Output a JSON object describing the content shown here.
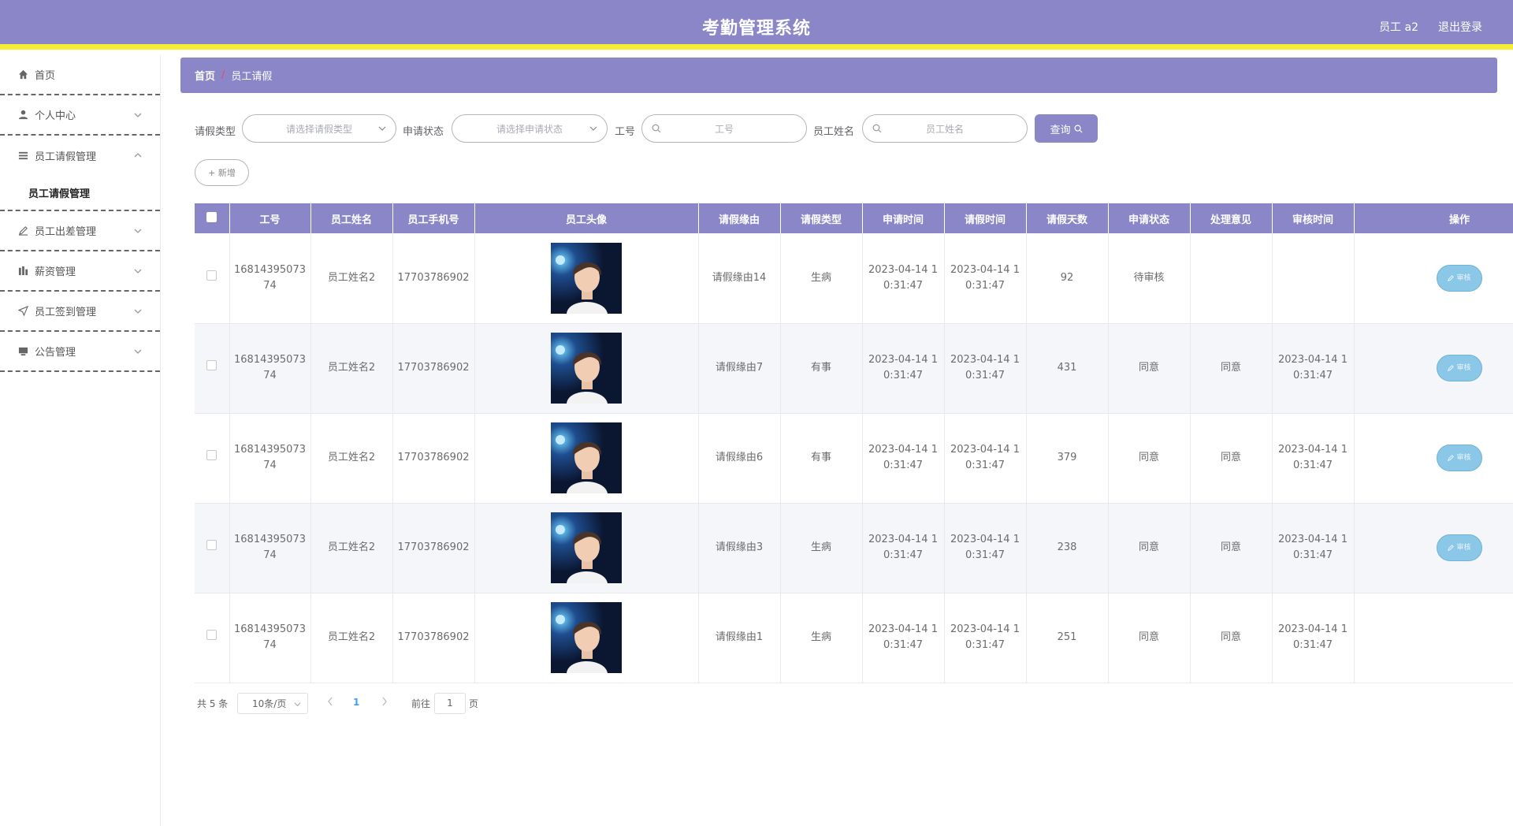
{
  "header": {
    "title": "考勤管理系统",
    "user": "员工 a2",
    "logout": "退出登录"
  },
  "sidebar": {
    "items": [
      {
        "label": "首页",
        "icon": "home-icon"
      },
      {
        "label": "个人中心",
        "icon": "user-icon"
      },
      {
        "label": "员工请假管理",
        "icon": "list-icon",
        "sub": "员工请假管理"
      },
      {
        "label": "员工出差管理",
        "icon": "edit-icon"
      },
      {
        "label": "薪资管理",
        "icon": "chart-icon"
      },
      {
        "label": "员工签到管理",
        "icon": "send-icon"
      },
      {
        "label": "公告管理",
        "icon": "monitor-icon"
      }
    ]
  },
  "breadcrumb": {
    "home": "首页",
    "separator": "/",
    "current": "员工请假"
  },
  "filters": {
    "leave_type_label": "请假类型",
    "leave_type_placeholder": "请选择请假类型",
    "status_label": "申请状态",
    "status_placeholder": "请选择申请状态",
    "emp_no_label": "工号",
    "emp_no_placeholder": "工号",
    "emp_name_label": "员工姓名",
    "emp_name_placeholder": "员工姓名",
    "query_label": "查询"
  },
  "add_button": "+ 新增",
  "table": {
    "columns": [
      "工号",
      "员工姓名",
      "员工手机号",
      "员工头像",
      "请假缘由",
      "请假类型",
      "申请时间",
      "请假时间",
      "请假天数",
      "申请状态",
      "处理意见",
      "审核时间",
      "操作"
    ],
    "rows": [
      {
        "emp_no": "1681439507374",
        "name": "员工姓名2",
        "phone": "17703786902",
        "reason": "请假缘由14",
        "type": "生病",
        "apply_time": "2023-04-14 10:31:47",
        "leave_time": "2023-04-14 10:31:47",
        "days": "92",
        "status": "待审核",
        "opinion": "",
        "audit_time": "",
        "action": "审核"
      },
      {
        "emp_no": "1681439507374",
        "name": "员工姓名2",
        "phone": "17703786902",
        "reason": "请假缘由7",
        "type": "有事",
        "apply_time": "2023-04-14 10:31:47",
        "leave_time": "2023-04-14 10:31:47",
        "days": "431",
        "status": "同意",
        "opinion": "同意",
        "audit_time": "2023-04-14 10:31:47",
        "action": "审核"
      },
      {
        "emp_no": "1681439507374",
        "name": "员工姓名2",
        "phone": "17703786902",
        "reason": "请假缘由6",
        "type": "有事",
        "apply_time": "2023-04-14 10:31:47",
        "leave_time": "2023-04-14 10:31:47",
        "days": "379",
        "status": "同意",
        "opinion": "同意",
        "audit_time": "2023-04-14 10:31:47",
        "action": "审核"
      },
      {
        "emp_no": "1681439507374",
        "name": "员工姓名2",
        "phone": "17703786902",
        "reason": "请假缘由3",
        "type": "生病",
        "apply_time": "2023-04-14 10:31:47",
        "leave_time": "2023-04-14 10:31:47",
        "days": "238",
        "status": "同意",
        "opinion": "同意",
        "audit_time": "2023-04-14 10:31:47",
        "action": "审核"
      },
      {
        "emp_no": "1681439507374",
        "name": "员工姓名2",
        "phone": "17703786902",
        "reason": "请假缘由1",
        "type": "生病",
        "apply_time": "2023-04-14 10:31:47",
        "leave_time": "2023-04-14 10:31:47",
        "days": "251",
        "status": "同意",
        "opinion": "同意",
        "audit_time": "2023-04-14 10:31:47",
        "action": ""
      }
    ]
  },
  "pagination": {
    "total": "共 5 条",
    "page_size": "10条/页",
    "current": "1",
    "goto": "前往",
    "goto_value": "1",
    "unit": "页"
  },
  "colors": {
    "primary": "#8a86c7",
    "accent_bar": "#f5ee35",
    "audit_button": "#8bc7e6"
  }
}
